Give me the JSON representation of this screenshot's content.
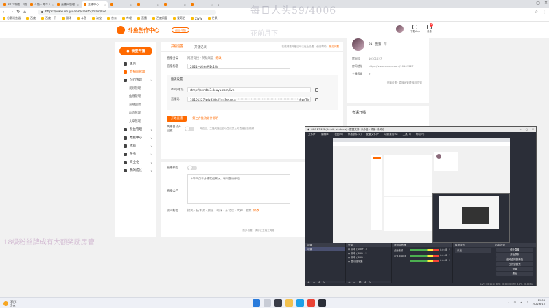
{
  "browser": {
    "tabs": [
      {
        "label": "2021领航...斗鱼",
        "active": false
      },
      {
        "label": "斗鱼 - 每个人",
        "active": false
      },
      {
        "label": "直播间管理",
        "active": false
      },
      {
        "label": "主播中心",
        "active": true
      },
      {
        "label": "",
        "active": false
      },
      {
        "label": "",
        "active": false
      },
      {
        "label": "",
        "active": false
      },
      {
        "label": "",
        "active": false
      }
    ],
    "url": "https://www.douyu.com/creator/main/live",
    "bookmarks": [
      "谷歌浏览器",
      "百度",
      "百度一下",
      "翻译",
      "斗鱼",
      "淘宝",
      "京东",
      "哔哩",
      "直播",
      "百度网盘",
      "爱奇艺",
      "ZWW",
      "芒果"
    ]
  },
  "watermarks": {
    "top": "每日人头59/4006",
    "top2": "花前月下",
    "left": "18级粉丝牌成有大额奖励房管"
  },
  "site": {
    "logo_text": "斗鱼创作中心",
    "logo_button": "返回斗鱼",
    "header_icons": [
      {
        "label": "下载App"
      },
      {
        "label": "消息",
        "badge": "4"
      }
    ]
  },
  "sidenav": {
    "live_button": "我要开播",
    "items": [
      {
        "label": "主页",
        "type": "item",
        "active": false
      },
      {
        "label": "直播间管理",
        "type": "item",
        "active": true
      },
      {
        "label": "创作管理",
        "type": "group"
      },
      {
        "label": "视频管理",
        "type": "sub"
      },
      {
        "label": "鱼塘管理",
        "type": "sub"
      },
      {
        "label": "直播回放",
        "type": "sub"
      },
      {
        "label": "动态管理",
        "type": "sub"
      },
      {
        "label": "文章管理",
        "type": "sub"
      },
      {
        "label": "粉丝管理",
        "type": "group"
      },
      {
        "label": "数据中心",
        "type": "group"
      },
      {
        "label": "收益",
        "type": "group"
      },
      {
        "label": "任务",
        "type": "group"
      },
      {
        "label": "商业化",
        "type": "group"
      },
      {
        "label": "我的成长",
        "type": "group"
      }
    ]
  },
  "main": {
    "tabs": [
      "开播设置",
      "开播记录"
    ],
    "top_links": {
      "text": "在线观看开播后可以在此设置",
      "link1": "使用帮助",
      "link2": "常见问题"
    },
    "category_label": "直播分类",
    "category_value": "网游竞技 · 英雄联盟",
    "category_action": "修改",
    "title_label": "直播标题",
    "title_value": "2021一起来吧ID:1%",
    "push": {
      "title": "推流设置",
      "rtmp_label": "rtmp地址",
      "rtmp_value": "rtmp://sendtc3.douyu.com/live",
      "code_label": "直播码",
      "code_value": "10101227iwjyS3GdiYmrSecret=********************************************&wsTime=62a3e7"
    },
    "start_button": "开始直播",
    "obs_link": "第三方推流软件说明",
    "toggle1_label": "关播自动开回放",
    "toggle1_desc": "开启后，主播关播后自动生成并上传直播回放视频",
    "toggle2_label": "直播预告",
    "notice_label": "直播公告",
    "notice_text": "下午四点半开播欢迎来玩，有问题请评论",
    "tags_label": "房间标签",
    "tags_value": "搞笑 · 技术流 · 颜值 · 萌妹 · 东北话 · 大神 · 幽默",
    "tags_action": "修改",
    "bottom_link": "更多设置，请前往主播工具箱"
  },
  "rpanel": {
    "name": "21一我第一号",
    "rows": [
      {
        "label": "房间号",
        "value": "10101227"
      },
      {
        "label": "房间地址",
        "value": "https://www.douyu.com/10101227"
      },
      {
        "label": "主播等级",
        "value": "9"
      }
    ],
    "foot": "开播设置 · 直播间管理·使用须知",
    "card2_title": "粤语开播"
  },
  "obs": {
    "title": "OBS 27.2.3 (64-bit, windows) - 配置文件: 未命名 - 场景: 未命名",
    "menu": [
      "文件(F)",
      "编辑(E)",
      "视图(V)",
      "停靠部件(D)",
      "配置文件(P)",
      "场景集合(S)",
      "工具(T)",
      "帮助(H)"
    ],
    "scenes_header": "场景",
    "scenes": [
      "场景"
    ],
    "sources_header": "来源",
    "sources": [
      "文本 (GDI+) 3",
      "文本 (GDI+) 2",
      "文本 (GDI+)",
      "显示器采集"
    ],
    "mixer_header": "音频混音器",
    "mixer": [
      {
        "name": "桌面音频",
        "db": "0.0 dB"
      },
      {
        "name": "麦克风/Aux",
        "db": "0.0 dB"
      },
      {
        "name": "",
        "db": "0.0 dB"
      }
    ],
    "transitions_header": "转场特效",
    "transition_value": "淡出",
    "controls_header": "控制按钮",
    "controls": [
      "停止直播",
      "开始录制",
      "启动虚拟摄像机",
      "工作室模式",
      "设置",
      "退出"
    ],
    "status": "LIVE: 00:11:14   REC: 00:00:00   CPU: 5.1%, 30.00 fps"
  },
  "taskbar": {
    "weather_temp": "33°C",
    "weather_desc": "多云",
    "tray_lang": "中",
    "time": "19:03",
    "date": "2022/6/10"
  }
}
